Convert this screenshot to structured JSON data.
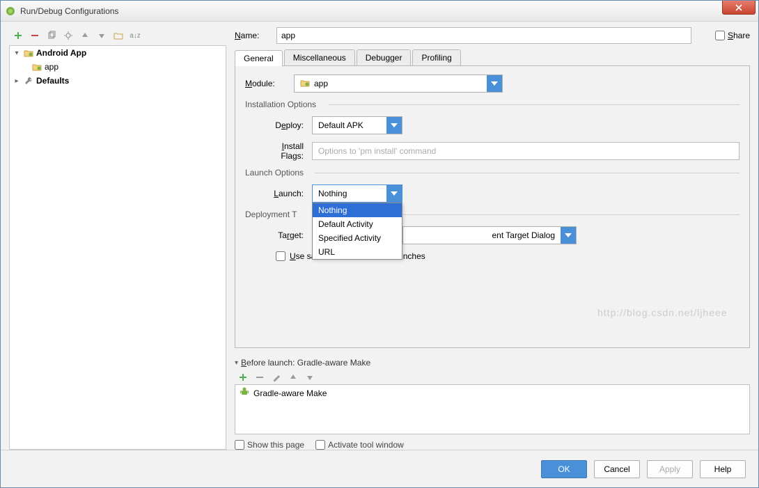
{
  "window": {
    "title": "Run/Debug Configurations"
  },
  "tree": {
    "root1": {
      "label": "Android App"
    },
    "child1": {
      "label": "app"
    },
    "root2": {
      "label": "Defaults"
    }
  },
  "name": {
    "label": "Name:",
    "value": "app"
  },
  "share": {
    "label": "Share"
  },
  "tabs": {
    "general": "General",
    "misc": "Miscellaneous",
    "debugger": "Debugger",
    "profiling": "Profiling"
  },
  "module": {
    "label": "Module:",
    "value": "app"
  },
  "install": {
    "section": "Installation Options",
    "deploy_label": "Deploy:",
    "deploy_value": "Default APK",
    "flags_label": "Install Flags:",
    "flags_placeholder": "Options to 'pm install' command"
  },
  "launch": {
    "section": "Launch Options",
    "label": "Launch:",
    "value": "Nothing",
    "options": [
      "Nothing",
      "Default Activity",
      "Specified Activity",
      "URL"
    ]
  },
  "deployment": {
    "section": "Deployment T",
    "target_label": "Target:",
    "target_value_suffix": "ent Target Dialog",
    "same_device": "Use same device for future launches"
  },
  "before": {
    "header": "Before launch: Gradle-aware Make",
    "item": "Gradle-aware Make"
  },
  "footer_checks": {
    "show": "Show this page",
    "activate": "Activate tool window"
  },
  "buttons": {
    "ok": "OK",
    "cancel": "Cancel",
    "apply": "Apply",
    "help": "Help"
  },
  "watermark": "http://blog.csdn.net/ljheee"
}
